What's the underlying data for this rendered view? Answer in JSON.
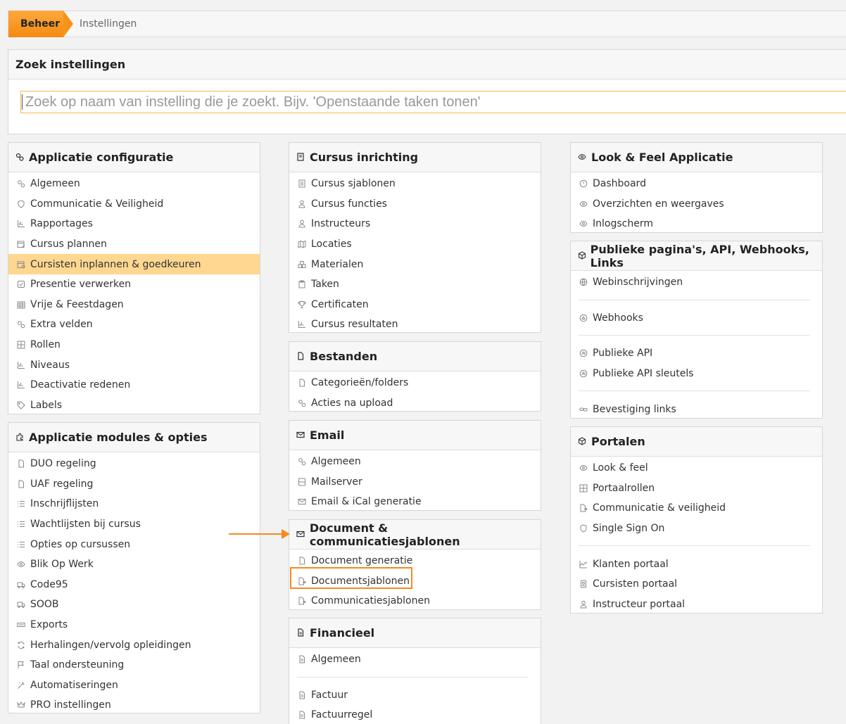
{
  "breadcrumb": {
    "active": "Beheer",
    "next": "Instellingen"
  },
  "search": {
    "title": "Zoek instellingen",
    "placeholder": "Zoek op naam van instelling die je zoekt. Bijv. 'Openstaande taken tonen'"
  },
  "panels": {
    "app_config": {
      "title": "Applicatie configuratie",
      "items": [
        {
          "label": "Algemeen",
          "icon": "gears-icon"
        },
        {
          "label": "Communicatie & Veiligheid",
          "icon": "shield-icon"
        },
        {
          "label": "Rapportages",
          "icon": "bar-chart-icon"
        },
        {
          "label": "Cursus plannen",
          "icon": "calendar-edit-icon"
        },
        {
          "label": "Cursisten inplannen & goedkeuren",
          "icon": "calendar-user-icon"
        },
        {
          "label": "Presentie verwerken",
          "icon": "check-square-icon"
        },
        {
          "label": "Vrije & Feestdagen",
          "icon": "calendar-grid-icon"
        },
        {
          "label": "Extra velden",
          "icon": "gears-icon"
        },
        {
          "label": "Rollen",
          "icon": "grid-icon"
        },
        {
          "label": "Niveaus",
          "icon": "bar-chart-icon"
        },
        {
          "label": "Deactivatie redenen",
          "icon": "bar-chart-icon"
        },
        {
          "label": "Labels",
          "icon": "tag-icon"
        }
      ]
    },
    "app_modules": {
      "title": "Applicatie modules & opties",
      "items": [
        {
          "label": "DUO regeling",
          "icon": "file-icon"
        },
        {
          "label": "UAF regeling",
          "icon": "file-icon"
        },
        {
          "label": "Inschrijflijsten",
          "icon": "list-icon"
        },
        {
          "label": "Wachtlijsten bij cursus",
          "icon": "list-icon"
        },
        {
          "label": "Opties op cursussen",
          "icon": "list-icon"
        },
        {
          "label": "Blik Op Werk",
          "icon": "eye-icon"
        },
        {
          "label": "Code95",
          "icon": "truck-icon"
        },
        {
          "label": "SOOB",
          "icon": "truck-icon"
        },
        {
          "label": "Exports",
          "icon": "keyboard-icon"
        },
        {
          "label": "Herhalingen/vervolg opleidingen",
          "icon": "refresh-icon"
        },
        {
          "label": "Taal ondersteuning",
          "icon": "flag-icon"
        },
        {
          "label": "Automatiseringen",
          "icon": "magic-icon"
        },
        {
          "label": "PRO instellingen",
          "icon": "crown-icon"
        }
      ]
    },
    "cursus": {
      "title": "Cursus inrichting",
      "items": [
        {
          "label": "Cursus sjablonen",
          "icon": "book-icon"
        },
        {
          "label": "Cursus functies",
          "icon": "user-tie-icon"
        },
        {
          "label": "Instructeurs",
          "icon": "user-tie-icon"
        },
        {
          "label": "Locaties",
          "icon": "map-icon"
        },
        {
          "label": "Materialen",
          "icon": "boxes-icon"
        },
        {
          "label": "Taken",
          "icon": "clipboard-icon"
        },
        {
          "label": "Certificaten",
          "icon": "trophy-icon"
        },
        {
          "label": "Cursus resultaten",
          "icon": "bar-chart-icon"
        }
      ]
    },
    "bestanden": {
      "title": "Bestanden",
      "items": [
        {
          "label": "Categorieën/folders",
          "icon": "file-icon"
        },
        {
          "label": "Acties na upload",
          "icon": "gears-icon"
        }
      ]
    },
    "email": {
      "title": "Email",
      "items": [
        {
          "label": "Algemeen",
          "icon": "gears-icon"
        },
        {
          "label": "Mailserver",
          "icon": "server-icon"
        },
        {
          "label": "Email & iCal generatie",
          "icon": "envelope-icon"
        }
      ]
    },
    "document": {
      "title": "Document & communicatiesjablonen",
      "items": [
        {
          "label": "Document generatie",
          "icon": "file-icon"
        },
        {
          "label": "Documentsjablonen",
          "icon": "file-export-icon"
        },
        {
          "label": "Communicatiesjablonen",
          "icon": "file-export-icon"
        }
      ]
    },
    "financieel": {
      "title": "Financieel",
      "items": [
        {
          "label": "Algemeen",
          "icon": "invoice-icon"
        },
        {
          "label": "Factuur",
          "icon": "invoice-icon"
        },
        {
          "label": "Factuurregel",
          "icon": "invoice-icon"
        }
      ]
    },
    "lookfeel": {
      "title": "Look & Feel Applicatie",
      "items": [
        {
          "label": "Dashboard",
          "icon": "gauge-icon"
        },
        {
          "label": "Overzichten en weergaves",
          "icon": "eye-icon"
        },
        {
          "label": "Inlogscherm",
          "icon": "eye-icon"
        }
      ]
    },
    "publiek": {
      "title": "Publieke pagina's, API, Webhooks, Links",
      "items": [
        {
          "label": "Webinschrijvingen",
          "icon": "globe-icon"
        },
        {
          "label": "Webhooks",
          "icon": "webhook-icon"
        },
        {
          "label": "Publieke API",
          "icon": "api-icon"
        },
        {
          "label": "Publieke API sleutels",
          "icon": "api-icon"
        },
        {
          "label": "Bevestiging links",
          "icon": "link-icon"
        }
      ]
    },
    "portalen": {
      "title": "Portalen",
      "items": [
        {
          "label": "Look & feel",
          "icon": "eye-icon"
        },
        {
          "label": "Portaalrollen",
          "icon": "grid-icon"
        },
        {
          "label": "Communicatie & veiligheid",
          "icon": "file-export-icon"
        },
        {
          "label": "Single Sign On",
          "icon": "shield-icon"
        },
        {
          "label": "Klanten portaal",
          "icon": "chart-area-icon"
        },
        {
          "label": "Cursisten portaal",
          "icon": "id-badge-icon"
        },
        {
          "label": "Instructeur portaal",
          "icon": "user-tie-icon"
        }
      ]
    }
  }
}
